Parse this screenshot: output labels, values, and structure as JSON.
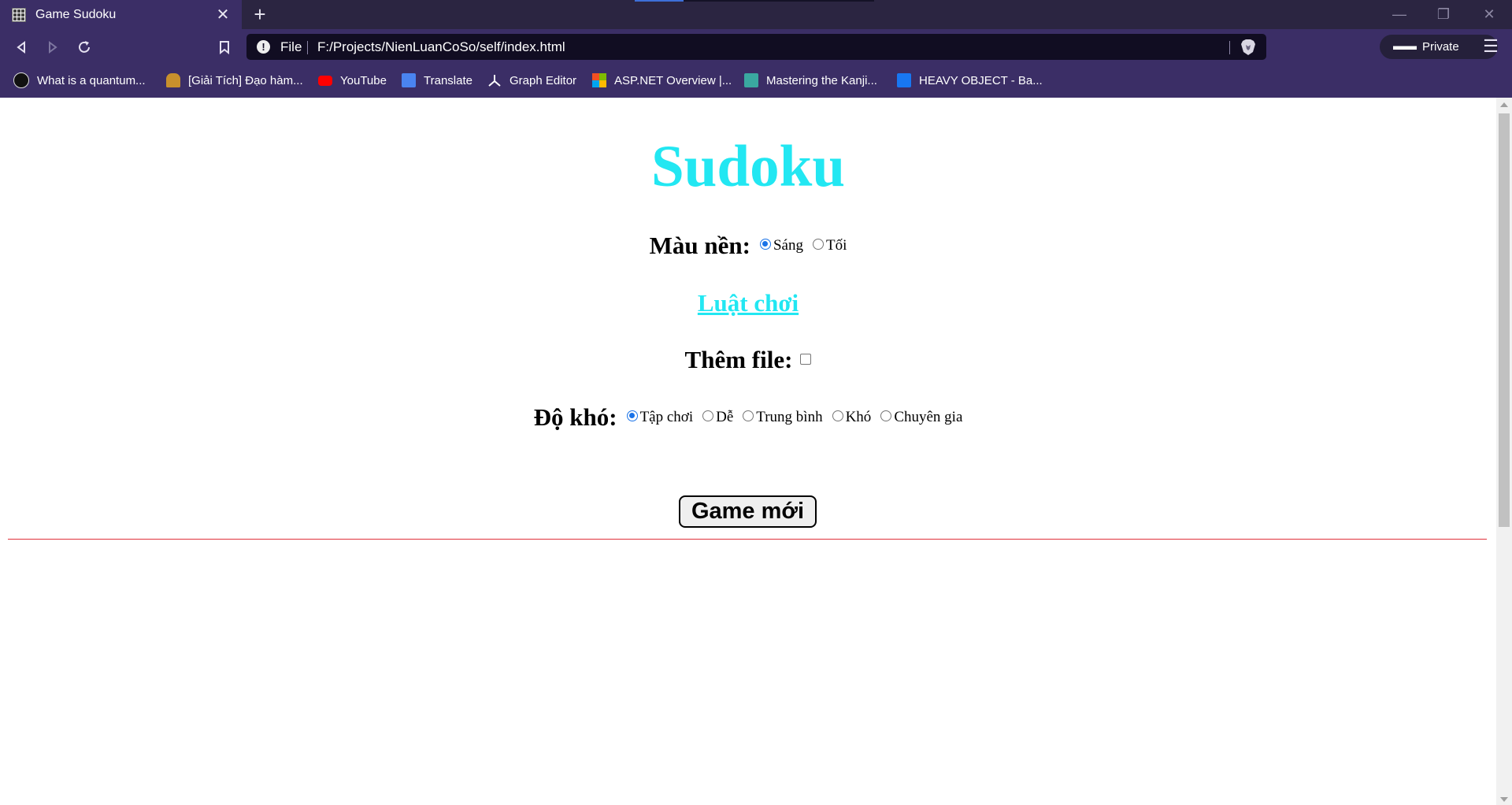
{
  "browser": {
    "tab": {
      "title": "Game Sudoku",
      "favicon": "sudoku-grid-icon"
    },
    "url": {
      "scheme": "File",
      "address": "F:/Projects/NienLuanCoSo/self/index.html"
    },
    "private_label": "Private",
    "bookmarks": [
      {
        "label": "What is a quantum...",
        "icon": "site-icon-dark"
      },
      {
        "label": "[Giải Tích] Đạo hàm...",
        "icon": "site-icon-figure"
      },
      {
        "label": "YouTube",
        "icon": "youtube-icon"
      },
      {
        "label": "Translate",
        "icon": "google-translate-icon"
      },
      {
        "label": "Graph Editor",
        "icon": "graph-editor-icon"
      },
      {
        "label": "ASP.NET Overview |...",
        "icon": "microsoft-icon"
      },
      {
        "label": "Mastering the Kanji...",
        "icon": "site-icon-teal"
      },
      {
        "label": "HEAVY OBJECT - Ba...",
        "icon": "site-icon-blue"
      }
    ],
    "colors": {
      "chrome": "#3b2e66",
      "tabbar": "#2b2541",
      "urlbar": "#110d22"
    }
  },
  "page": {
    "title": "Sudoku",
    "background": {
      "label": "Màu nền:",
      "options": [
        {
          "label": "Sáng",
          "checked": true
        },
        {
          "label": "Tối",
          "checked": false
        }
      ]
    },
    "rules_link": "Luật chơi",
    "add_file": {
      "label": "Thêm file:",
      "checked": false
    },
    "difficulty": {
      "label": "Độ khó:",
      "options": [
        {
          "label": "Tập chơi",
          "checked": true
        },
        {
          "label": "Dễ",
          "checked": false
        },
        {
          "label": "Trung bình",
          "checked": false
        },
        {
          "label": "Khó",
          "checked": false
        },
        {
          "label": "Chuyên gia",
          "checked": false
        }
      ]
    },
    "new_game_button": "Game mới",
    "colors": {
      "title": "#22e7f2",
      "divider": "#e0303a"
    }
  }
}
